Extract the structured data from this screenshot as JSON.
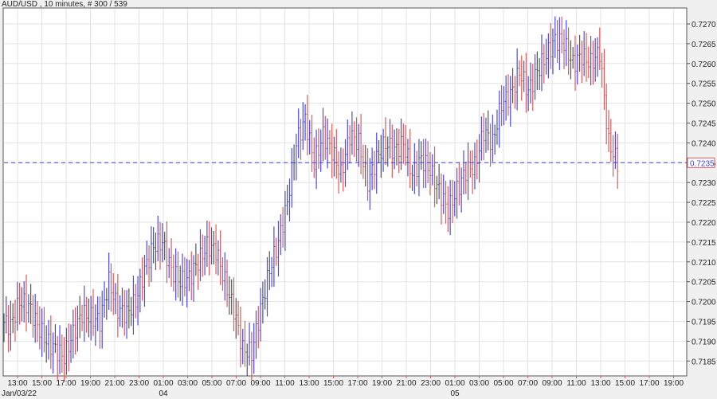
{
  "header": {
    "title": "AUD/USD , 10 minutes, # 300 / 539"
  },
  "chart_data": {
    "type": "ohlc",
    "title": "AUD/USD , 10 minutes, # 300 / 539",
    "ylim": [
      0.7181,
      0.7277
    ],
    "yticks": [
      "0.7185",
      "0.7190",
      "0.7195",
      "0.7200",
      "0.7205",
      "0.7210",
      "0.7215",
      "0.7220",
      "0.7225",
      "0.7230",
      "0.7235",
      "0.7240",
      "0.7245",
      "0.7250",
      "0.7255",
      "0.7260",
      "0.7265",
      "0.7270"
    ],
    "xticks": [
      "13:00",
      "15:00",
      "17:00",
      "19:00",
      "21:00",
      "23:00",
      "01:00",
      "03:00",
      "05:00",
      "07:00",
      "09:00",
      "11:00",
      "13:00",
      "15:00",
      "17:00",
      "19:00",
      "21:00",
      "23:00",
      "01:00",
      "03:00",
      "05:00",
      "07:00",
      "09:00",
      "11:00",
      "13:00",
      "15:00",
      "17:00",
      "19:00"
    ],
    "date_labels": [
      {
        "label": "Jan/03/22",
        "tick": 0
      },
      {
        "label": "04",
        "tick": 6
      },
      {
        "label": "05",
        "tick": 18
      }
    ],
    "current_price": "0.7235",
    "approx_closes": [
      0.7195,
      0.7194,
      0.72,
      0.7199,
      0.7194,
      0.719,
      0.7188,
      0.7186,
      0.7192,
      0.7197,
      0.7196,
      0.7195,
      0.7205,
      0.7198,
      0.7197,
      0.72,
      0.7208,
      0.7214,
      0.7215,
      0.7208,
      0.7205,
      0.7206,
      0.721,
      0.7214,
      0.7213,
      0.7205,
      0.7198,
      0.7188,
      0.7187,
      0.7198,
      0.7208,
      0.7215,
      0.7225,
      0.724,
      0.7246,
      0.7235,
      0.7242,
      0.7238,
      0.7232,
      0.7242,
      0.724,
      0.723,
      0.7236,
      0.724,
      0.7238,
      0.724,
      0.7232,
      0.7236,
      0.7233,
      0.7228,
      0.7223,
      0.7228,
      0.7233,
      0.7234,
      0.7243,
      0.724,
      0.725,
      0.7252,
      0.7258,
      0.7253,
      0.7258,
      0.7262,
      0.7266,
      0.7265,
      0.726,
      0.7262,
      0.726,
      0.7263,
      0.724,
      0.7235
    ],
    "colors": {
      "up": "#4b4bf0",
      "down": "#e05a5a",
      "flat": "#555555",
      "current_line": "#4040e0"
    }
  }
}
